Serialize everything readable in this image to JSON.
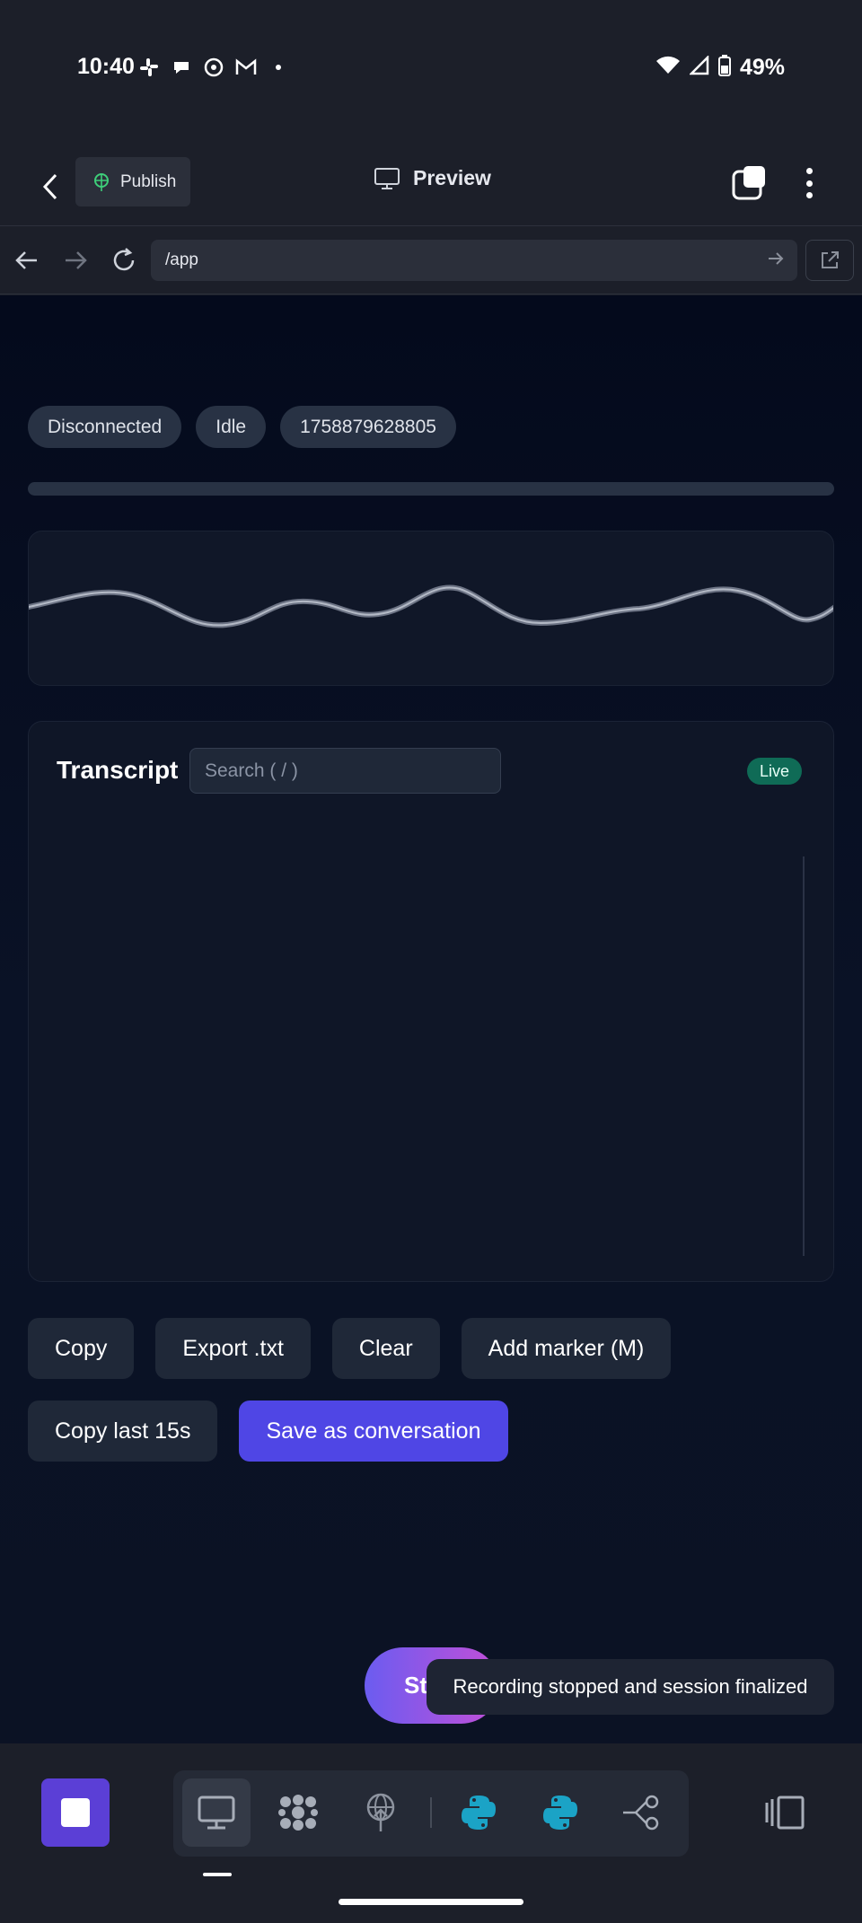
{
  "status_bar": {
    "time": "10:40",
    "battery": "49%",
    "notification_icons": [
      "slack-icon",
      "chat-icon",
      "whatsapp-icon",
      "gmail-icon",
      "dot-icon"
    ]
  },
  "top_bar": {
    "publish_label": "Publish",
    "preview_label": "Preview"
  },
  "url_bar": {
    "url": "/app"
  },
  "app": {
    "pills": [
      "Disconnected",
      "Idle",
      "1758879628805"
    ],
    "transcript": {
      "title": "Transcript",
      "search_placeholder": "Search ( / )",
      "live_label": "Live"
    },
    "buttons_row1": [
      "Copy",
      "Export .txt",
      "Clear",
      "Add marker (M)"
    ],
    "buttons_row2": [
      "Copy last 15s",
      "Save as conversation"
    ],
    "start_label": "Start",
    "toast": "Recording stopped and session finalized"
  },
  "colors": {
    "background": "#1c1f29",
    "app_background": "#0a1226",
    "primary": "#4f46e5",
    "live_badge": "#0f6b56",
    "stop_button": "#5b3fd6",
    "python_icon": "#1ba3c6"
  },
  "bottom_bar": {
    "tools": [
      "desktop-icon",
      "nodes-icon",
      "publish-icon",
      "python-icon",
      "python-icon",
      "flow-icon"
    ]
  }
}
